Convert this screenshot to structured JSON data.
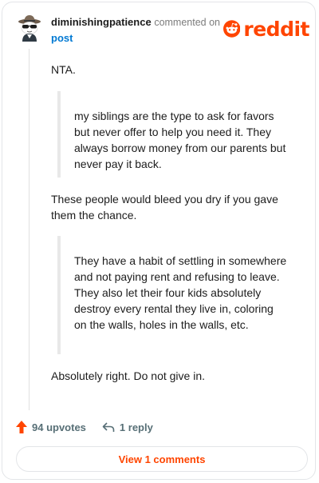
{
  "comment": {
    "username": "diminishingpatience",
    "commented_text": "commented on",
    "post_link": "post",
    "brand": "reddit",
    "paragraphs": [
      "NTA.",
      "These people would bleed you dry if you gave them the chance.",
      "Absolutely right. Do not give in."
    ],
    "quotes": [
      "my siblings are the type to ask for favors but never offer to help you need it. They always borrow money from our parents but never pay it back.",
      "They have a habit of settling in somewhere and not paying rent and refusing to leave. They also let their four kids absolutely destroy every rental they live in, coloring on the walls, holes in the walls, etc."
    ]
  },
  "actions": {
    "upvotes": "94 upvotes",
    "reply": "1 reply",
    "view_comments": "View 1 comments"
  },
  "colors": {
    "brand": "#ff4500",
    "link": "#0079d3",
    "muted": "#576f76"
  }
}
